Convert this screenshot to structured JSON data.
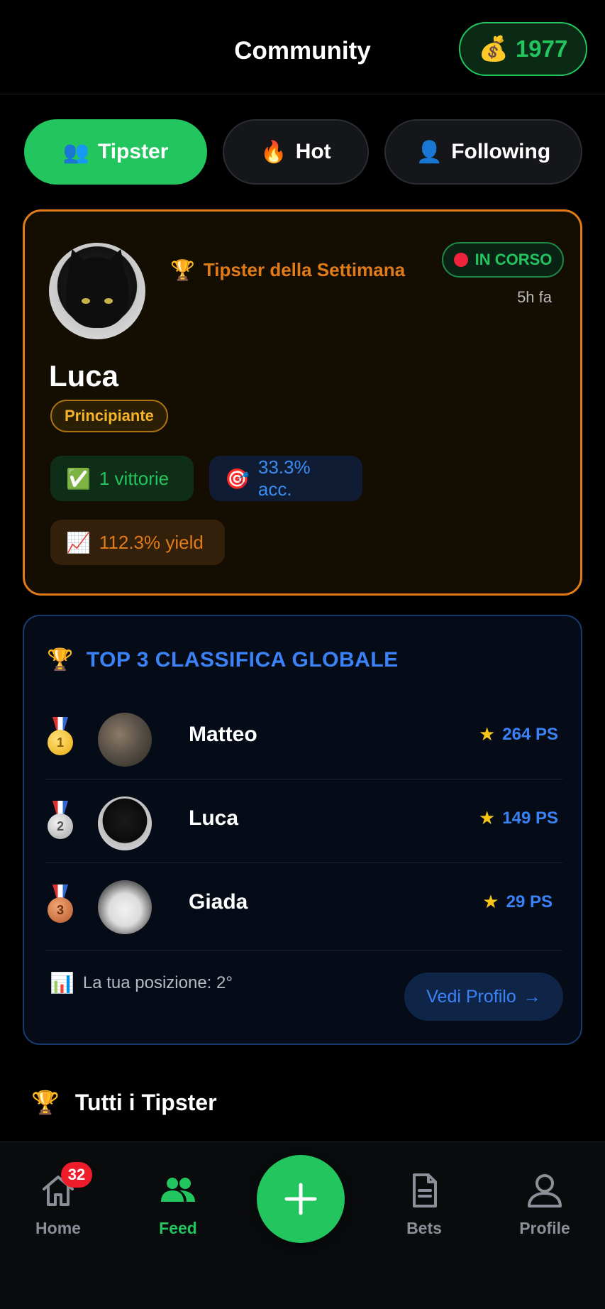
{
  "header": {
    "title": "Community",
    "coins": "1977",
    "coins_icon": "money-bag-icon"
  },
  "tabs": [
    {
      "label": "Tipster",
      "icon": "users-icon",
      "active": true
    },
    {
      "label": "Hot",
      "icon": "fire-icon",
      "active": false
    },
    {
      "label": "Following",
      "icon": "user-icon",
      "active": false
    }
  ],
  "tipster_of_week": {
    "label": "Tipster della Settimana",
    "status": "IN CORSO",
    "time": "5h fa",
    "name": "Luca",
    "level": "Principiante",
    "wins": "1 vittorie",
    "accuracy": "33.3% acc.",
    "yield": "112.3% yield"
  },
  "leaderboard": {
    "title": "TOP 3 CLASSIFICA GLOBALE",
    "rows": [
      {
        "rank": "1",
        "name": "Matteo",
        "points": "264 PS"
      },
      {
        "rank": "2",
        "name": "Luca",
        "points": "149 PS"
      },
      {
        "rank": "3",
        "name": "Giada",
        "points": "29 PS"
      }
    ],
    "position": "La tua posizione: 2°",
    "button": "Vedi Profilo",
    "button_arrow": "→"
  },
  "section": {
    "title": "Tutti i Tipster"
  },
  "nav": {
    "home": {
      "label": "Home",
      "badge": "32"
    },
    "feed": {
      "label": "Feed"
    },
    "bets": {
      "label": "Bets"
    },
    "profile": {
      "label": "Profile"
    }
  },
  "colors": {
    "accent": "#22c55e",
    "orange": "#e07b17",
    "blue": "#3b82f6",
    "background": "#000000"
  }
}
